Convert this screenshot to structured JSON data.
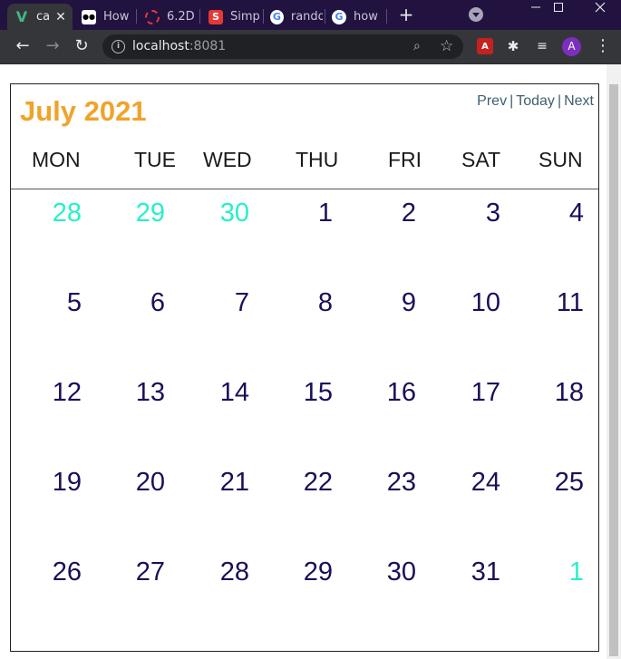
{
  "browser": {
    "tabs": [
      {
        "title": "ca",
        "favicon": "V",
        "favicon_color": "#42b883",
        "active": true
      },
      {
        "title": "How",
        "favicon": "●●",
        "favicon_color": "#ffffff",
        "active": false
      },
      {
        "title": "6.2D",
        "favicon": "○",
        "favicon_color": "#e53935",
        "active": false
      },
      {
        "title": "Simp",
        "favicon": "S",
        "favicon_color": "#e53935",
        "active": false
      },
      {
        "title": "rando",
        "favicon": "G",
        "favicon_color": "#4285f4",
        "active": false
      },
      {
        "title": "how",
        "favicon": "G",
        "favicon_color": "#4285f4",
        "active": false
      }
    ],
    "url_host": "localhost",
    "url_port": ":8081",
    "profile_initial": "A"
  },
  "calendar": {
    "title": "July 2021",
    "nav": {
      "prev": "Prev",
      "today": "Today",
      "next": "Next",
      "separator": "|"
    },
    "weekdays": [
      "MON",
      "TUE",
      "WED",
      "THU",
      "FRI",
      "SAT",
      "SUN"
    ],
    "weeks": [
      [
        {
          "day": "28",
          "other": true
        },
        {
          "day": "29",
          "other": true
        },
        {
          "day": "30",
          "other": true
        },
        {
          "day": "1"
        },
        {
          "day": "2"
        },
        {
          "day": "3"
        },
        {
          "day": "4"
        }
      ],
      [
        {
          "day": "5"
        },
        {
          "day": "6"
        },
        {
          "day": "7"
        },
        {
          "day": "8"
        },
        {
          "day": "9"
        },
        {
          "day": "10"
        },
        {
          "day": "11"
        }
      ],
      [
        {
          "day": "12"
        },
        {
          "day": "13"
        },
        {
          "day": "14"
        },
        {
          "day": "15"
        },
        {
          "day": "16"
        },
        {
          "day": "17"
        },
        {
          "day": "18"
        }
      ],
      [
        {
          "day": "19"
        },
        {
          "day": "20"
        },
        {
          "day": "21"
        },
        {
          "day": "22"
        },
        {
          "day": "23"
        },
        {
          "day": "24"
        },
        {
          "day": "25"
        }
      ],
      [
        {
          "day": "26"
        },
        {
          "day": "27"
        },
        {
          "day": "28"
        },
        {
          "day": "29"
        },
        {
          "day": "30"
        },
        {
          "day": "31"
        },
        {
          "day": "1",
          "other": true
        }
      ]
    ],
    "colors": {
      "title": "#f0a32b",
      "current_month_day": "#1b0f59",
      "other_month_day": "#28f0c8"
    }
  }
}
